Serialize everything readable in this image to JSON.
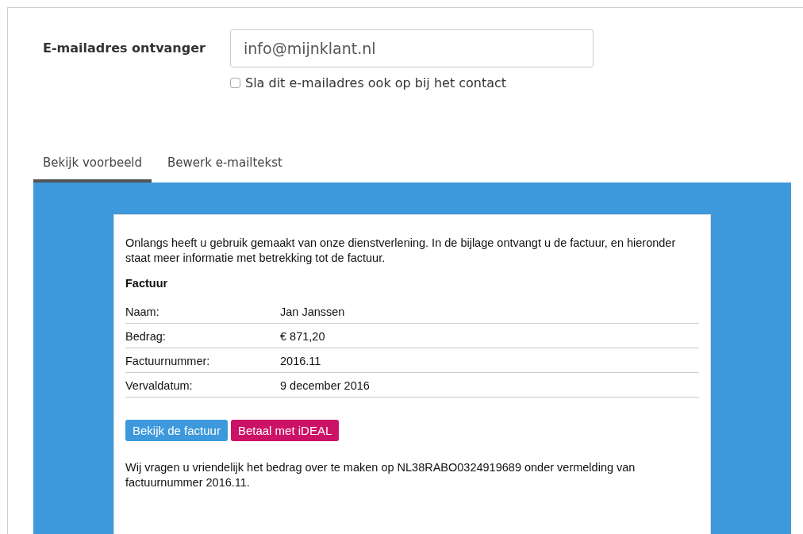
{
  "recipient": {
    "label": "E-mailadres ontvanger",
    "value": "info@mijnklant.nl",
    "save_option": {
      "label": "Sla dit e-mailadres ook op bij het contact",
      "checked": false
    }
  },
  "tabs": [
    {
      "label": "Bekijk voorbeeld",
      "selected": true
    },
    {
      "label": "Bewerk e-mailtekst",
      "selected": false
    }
  ],
  "email_preview": {
    "intro": "Onlangs heeft u gebruik gemaakt van onze dienstverlening. In de bijlage ontvangt u de factuur, en hieronder staat meer informatie met betrekking tot de factuur.",
    "heading": "Factuur",
    "rows": [
      {
        "label": "Naam:",
        "value": "Jan Janssen"
      },
      {
        "label": "Bedrag:",
        "value": "€ 871,20"
      },
      {
        "label": "Factuurnummer:",
        "value": "2016.11"
      },
      {
        "label": "Vervaldatum:",
        "value": "9 december 2016"
      }
    ],
    "buttons": [
      {
        "label": "Bekijk de factuur",
        "kind": "view"
      },
      {
        "label": "Betaal met iDEAL",
        "kind": "pay"
      }
    ],
    "footer": "Wij vragen u vriendelijk het bedrag over te maken op NL38RABO0324919689 onder vermelding van factuurnummer 2016.11."
  }
}
